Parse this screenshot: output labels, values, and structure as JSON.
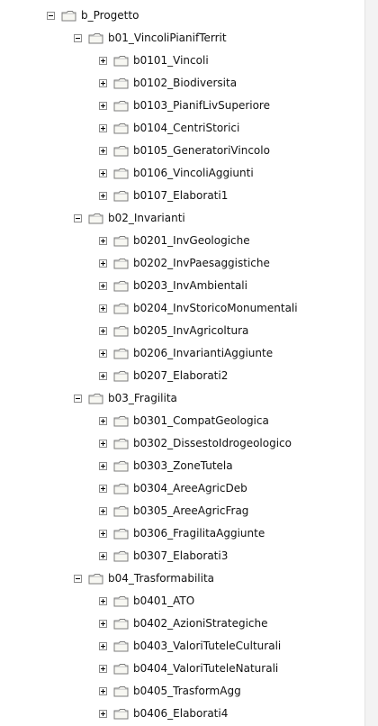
{
  "tree": {
    "root": {
      "label": "b_Progetto",
      "state": "expanded"
    },
    "groups": [
      {
        "label": "b01_VincoliPianifTerrit",
        "state": "expanded",
        "children": [
          "b0101_Vincoli",
          "b0102_Biodiversita",
          "b0103_PianifLivSuperiore",
          "b0104_CentriStorici",
          "b0105_GeneratoriVincolo",
          "b0106_VincoliAggiunti",
          "b0107_Elaborati1"
        ]
      },
      {
        "label": "b02_Invarianti",
        "state": "expanded",
        "children": [
          "b0201_InvGeologiche",
          "b0202_InvPaesaggistiche",
          "b0203_InvAmbientali",
          "b0204_InvStoricoMonumentali",
          "b0205_InvAgricoltura",
          "b0206_InvariantiAggiunte",
          "b0207_Elaborati2"
        ]
      },
      {
        "label": "b03_Fragilita",
        "state": "expanded",
        "children": [
          "b0301_CompatGeologica",
          "b0302_DissestoIdrogeologico",
          "b0303_ZoneTutela",
          "b0304_AreeAgricDeb",
          "b0305_AreeAgricFrag",
          "b0306_FragilitaAggiunte",
          "b0307_Elaborati3"
        ]
      },
      {
        "label": "b04_Trasformabilita",
        "state": "expanded",
        "children": [
          "b0401_ATO",
          "b0402_AzioniStrategiche",
          "b0403_ValoriTuteleCulturali",
          "b0404_ValoriTuteleNaturali",
          "b0405_TrasformAgg",
          "b0406_Elaborati4"
        ]
      }
    ],
    "icons": {
      "folder": "folder-icon",
      "expanded_toggle": "minus-box-icon",
      "collapsed_toggle": "plus-box-icon"
    },
    "colors": {
      "folder_fill": "#f7f7f2",
      "folder_outline": "#7c7c7c",
      "toggle_border": "#8c8c8c"
    }
  }
}
